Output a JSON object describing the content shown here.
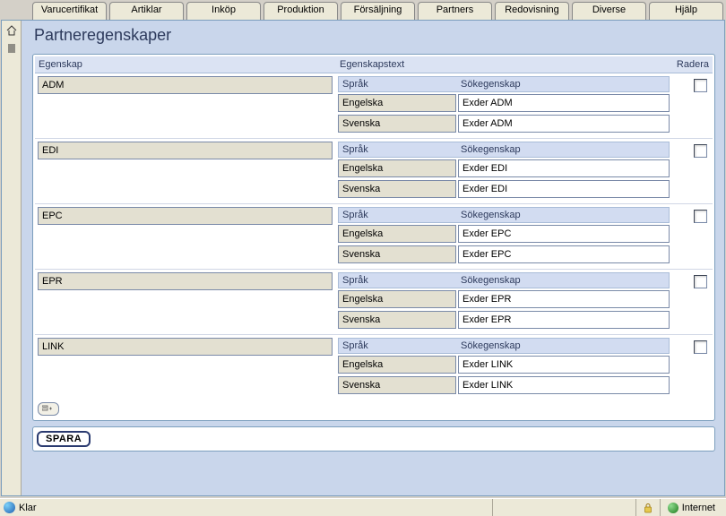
{
  "menu": [
    "Varucertifikat",
    "Artiklar",
    "Inköp",
    "Produktion",
    "Försäljning",
    "Partners",
    "Redovisning",
    "Diverse",
    "Hjälp"
  ],
  "page_title": "Partneregenskaper",
  "columns": {
    "property": "Egenskap",
    "text": "Egenskapstext",
    "delete": "Radera"
  },
  "lang_columns": {
    "lang": "Språk",
    "search": "Sökegenskap"
  },
  "rows": [
    {
      "code": "ADM",
      "langs": [
        {
          "lang": "Engelska",
          "val": "Exder ADM"
        },
        {
          "lang": "Svenska",
          "val": "Exder ADM"
        }
      ]
    },
    {
      "code": "EDI",
      "langs": [
        {
          "lang": "Engelska",
          "val": "Exder EDI"
        },
        {
          "lang": "Svenska",
          "val": "Exder EDI"
        }
      ]
    },
    {
      "code": "EPC",
      "langs": [
        {
          "lang": "Engelska",
          "val": "Exder EPC"
        },
        {
          "lang": "Svenska",
          "val": "Exder EPC"
        }
      ]
    },
    {
      "code": "EPR",
      "langs": [
        {
          "lang": "Engelska",
          "val": "Exder EPR"
        },
        {
          "lang": "Svenska",
          "val": "Exder EPR"
        }
      ]
    },
    {
      "code": "LINK",
      "langs": [
        {
          "lang": "Engelska",
          "val": "Exder LINK"
        },
        {
          "lang": "Svenska",
          "val": "Exder LINK"
        }
      ]
    }
  ],
  "save_label": "SPARA",
  "status": {
    "ready": "Klar",
    "zone": "Internet"
  }
}
